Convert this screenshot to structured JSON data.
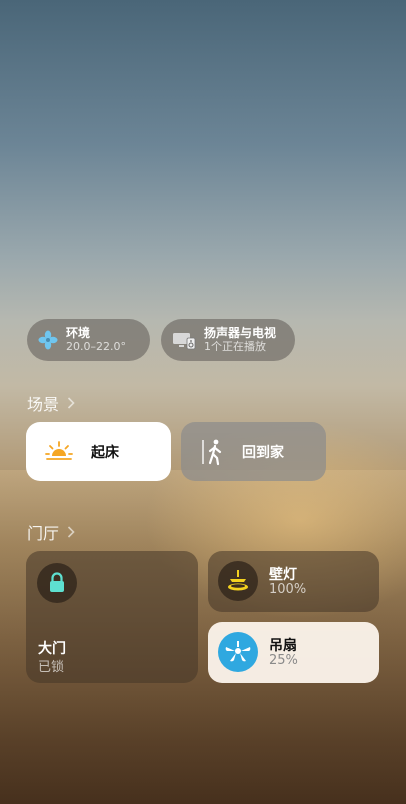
{
  "status_pills": [
    {
      "icon": "fan-icon",
      "title": "环境",
      "subtitle": "20.0–22.0°"
    },
    {
      "icon": "tv-speaker-icon",
      "title": "扬声器与电视",
      "subtitle": "1个正在播放"
    }
  ],
  "scenes_section": {
    "title": "场景",
    "items": [
      {
        "icon": "sunrise-icon",
        "label": "起床",
        "active": true
      },
      {
        "icon": "walking-person-icon",
        "label": "回到家",
        "active": false
      }
    ]
  },
  "room_section": {
    "title": "门厅",
    "door": {
      "icon": "lock-icon",
      "title": "大门",
      "status": "已锁"
    },
    "wall_light": {
      "icon": "ceiling-light-icon",
      "title": "壁灯",
      "status": "100%"
    },
    "ceiling_fan": {
      "icon": "ceiling-fan-icon",
      "title": "吊扇",
      "status": "25%"
    }
  },
  "colors": {
    "accent_orange": "#f5a623",
    "fan_blue": "#2fa8e0",
    "lock_teal": "#5ee0d0",
    "light_yellow": "#f4d21f"
  }
}
